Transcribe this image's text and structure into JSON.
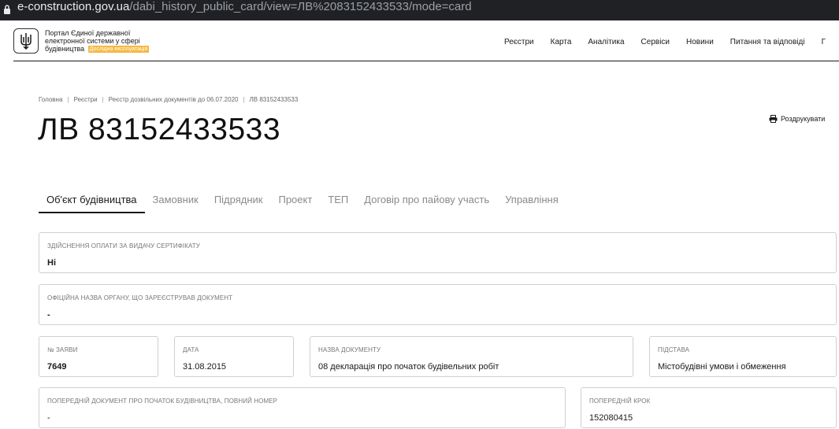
{
  "browser": {
    "url_host": "e-construction.gov.ua",
    "url_path": "/dabi_history_public_card/view=ЛВ%2083152433533/mode=card"
  },
  "header": {
    "portal_title": "Портал Єдиної державної електронної системи у сфері будівництва",
    "badge": "Дослідна експлуатація",
    "nav": [
      "Реєстри",
      "Карта",
      "Аналітика",
      "Сервіси",
      "Новини",
      "Питання та відповіді",
      "Г"
    ]
  },
  "breadcrumb": [
    "Головна",
    "Реєстри",
    "Реєстр дозвільних документів до 06.07.2020",
    "ЛВ 83152433533"
  ],
  "page": {
    "title": "ЛВ 83152433533",
    "print_label": "Роздрукувати"
  },
  "tabs": [
    "Об'єкт будівництва",
    "Замовник",
    "Підрядник",
    "Проект",
    "ТЕП",
    "Договір про пайову участь",
    "Управління"
  ],
  "fields": {
    "payment": {
      "label": "Здійснення оплати за видачу сертифікату",
      "value": "Ні"
    },
    "authority": {
      "label": "Офіційна назва органу, що зареєстрував документ",
      "value": "-"
    },
    "application_no": {
      "label": "№ заяви",
      "value": "7649"
    },
    "date": {
      "label": "Дата",
      "value": "31.08.2015"
    },
    "doc_name": {
      "label": "Назва документу",
      "value": "08 декларація про початок будівельних робіт"
    },
    "basis": {
      "label": "Підстава",
      "value": "Містобудівні умови і обмеження"
    },
    "prev_doc": {
      "label": "Попередній документ про початок будівництва, повний номер",
      "value": "-"
    },
    "prev_step": {
      "label": "Попередній крок",
      "value": "152080415"
    }
  }
}
